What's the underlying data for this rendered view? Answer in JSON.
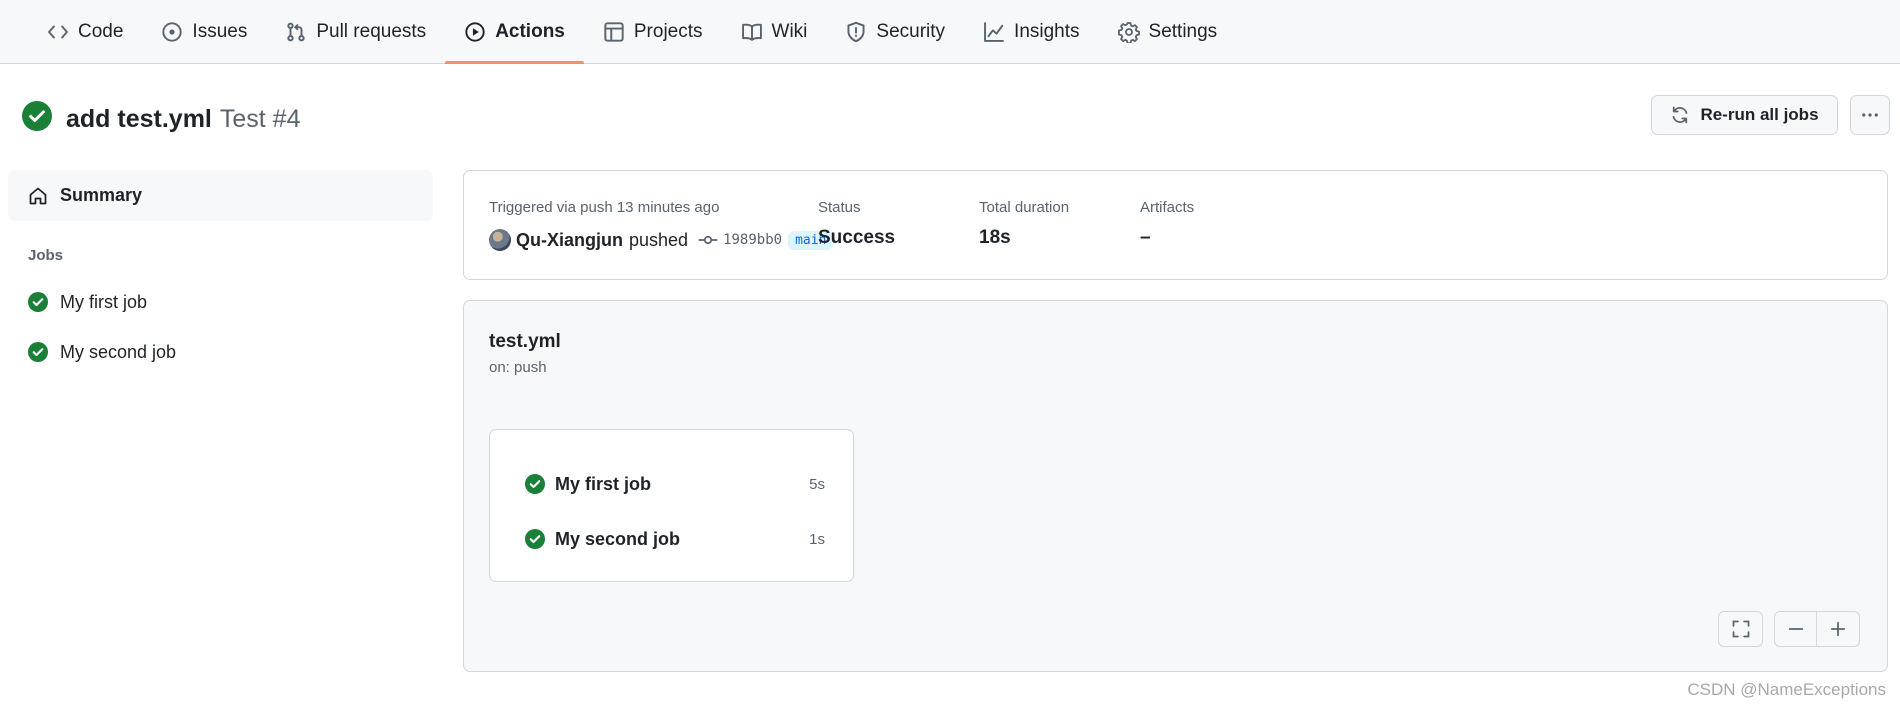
{
  "nav": {
    "tabs": [
      {
        "label": "Code",
        "icon": "code-icon"
      },
      {
        "label": "Issues",
        "icon": "issue-opened-icon"
      },
      {
        "label": "Pull requests",
        "icon": "git-pull-request-icon"
      },
      {
        "label": "Actions",
        "icon": "play-icon",
        "active": true
      },
      {
        "label": "Projects",
        "icon": "table-icon"
      },
      {
        "label": "Wiki",
        "icon": "book-icon"
      },
      {
        "label": "Security",
        "icon": "shield-icon"
      },
      {
        "label": "Insights",
        "icon": "graph-icon"
      },
      {
        "label": "Settings",
        "icon": "gear-icon"
      }
    ]
  },
  "header": {
    "status": "success",
    "title": "add test.yml",
    "subtitle": "Test #4",
    "rerun_label": "Re-run all jobs",
    "more_icon": "kebab-horizontal-icon"
  },
  "sidebar": {
    "summary_label": "Summary",
    "jobs_heading": "Jobs",
    "jobs": [
      {
        "name": "My first job",
        "status": "success"
      },
      {
        "name": "My second job",
        "status": "success"
      }
    ]
  },
  "summary": {
    "trigger_text": "Triggered via push 13 minutes ago",
    "actor": "Qu-Xiangjun",
    "action": "pushed",
    "commit_sha": "1989bb0",
    "branch": "main",
    "status_label": "Status",
    "status_value": "Success",
    "duration_label": "Total duration",
    "duration_value": "18s",
    "artifacts_label": "Artifacts",
    "artifacts_value": "–"
  },
  "workflow": {
    "file": "test.yml",
    "trigger": "on: push",
    "jobs": [
      {
        "name": "My first job",
        "duration": "5s",
        "status": "success"
      },
      {
        "name": "My second job",
        "duration": "1s",
        "status": "success"
      }
    ]
  },
  "colors": {
    "success": "#1a7f37",
    "accent_underline": "#fd8c73",
    "link": "#0969da"
  },
  "watermark": "CSDN @NameExceptions"
}
